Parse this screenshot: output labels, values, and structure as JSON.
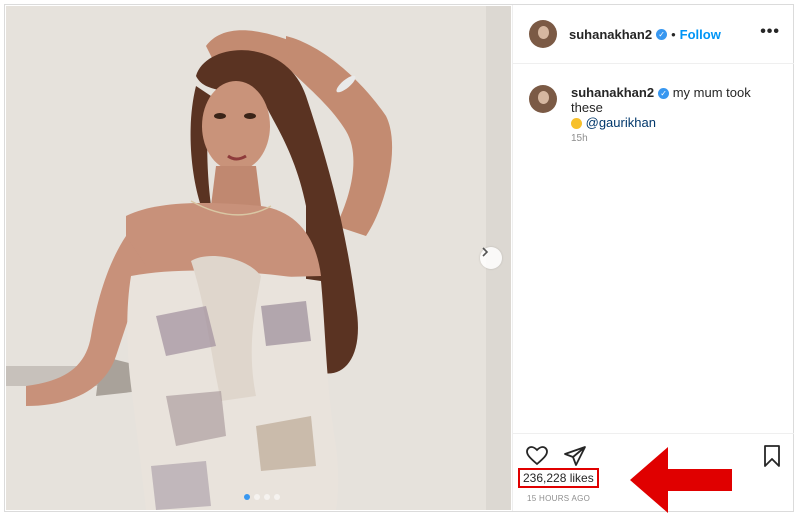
{
  "post": {
    "username": "suhanakhan2",
    "follow_label": "Follow",
    "separator": "•",
    "more_label": "•••",
    "caption_text": "my mum took these",
    "caption_mention": "@gaurikhan",
    "caption_time": "15h",
    "likes": "236,228 likes",
    "posted_ago": "15 HOURS AGO",
    "carousel_total": 4,
    "carousel_active": 1
  },
  "colors": {
    "accent": "#0095f6",
    "verified": "#3897f0",
    "highlight": "#e00000"
  },
  "icons": [
    "verified-badge-icon",
    "more-options-icon",
    "heart-icon",
    "share-icon",
    "bookmark-icon",
    "chevron-right-icon",
    "red-arrow-annotation"
  ]
}
